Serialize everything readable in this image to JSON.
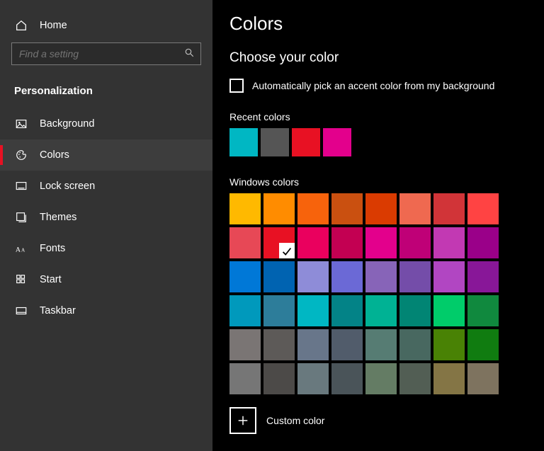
{
  "sidebar": {
    "home_label": "Home",
    "search_placeholder": "Find a setting",
    "section_title": "Personalization",
    "items": [
      {
        "label": "Background",
        "icon": "picture-icon",
        "active": false
      },
      {
        "label": "Colors",
        "icon": "palette-icon",
        "active": true
      },
      {
        "label": "Lock screen",
        "icon": "lockscreen-icon",
        "active": false
      },
      {
        "label": "Themes",
        "icon": "themes-icon",
        "active": false
      },
      {
        "label": "Fonts",
        "icon": "fonts-icon",
        "active": false
      },
      {
        "label": "Start",
        "icon": "start-icon",
        "active": false
      },
      {
        "label": "Taskbar",
        "icon": "taskbar-icon",
        "active": false
      }
    ]
  },
  "main": {
    "page_title": "Colors",
    "choose_label": "Choose your color",
    "auto_pick_label": "Automatically pick an accent color from my background",
    "auto_pick_checked": false,
    "recent_label": "Recent colors",
    "recent_colors": [
      "#00b7c3",
      "#555555",
      "#e81123",
      "#e3008c"
    ],
    "windows_label": "Windows colors",
    "selected_index": 9,
    "windows_colors": [
      "#ffb900",
      "#ff8c00",
      "#f7630c",
      "#ca5010",
      "#da3b01",
      "#ef6950",
      "#d13438",
      "#ff4343",
      "#e74856",
      "#e81123",
      "#ea005e",
      "#c30052",
      "#e3008c",
      "#bf0077",
      "#c239b3",
      "#9a0089",
      "#0078d7",
      "#0063b1",
      "#8e8cd8",
      "#6b69d6",
      "#8764b8",
      "#744da9",
      "#b146c2",
      "#881798",
      "#0099bc",
      "#2d7d9a",
      "#00b7c3",
      "#038387",
      "#00b294",
      "#018574",
      "#00cc6a",
      "#10893e",
      "#7a7574",
      "#5d5a58",
      "#68768a",
      "#515c6b",
      "#567c73",
      "#486860",
      "#498205",
      "#107c10",
      "#767676",
      "#4c4a48",
      "#69797e",
      "#4a5459",
      "#647c64",
      "#525e54",
      "#847545",
      "#7e735f"
    ],
    "custom_label": "Custom color"
  }
}
